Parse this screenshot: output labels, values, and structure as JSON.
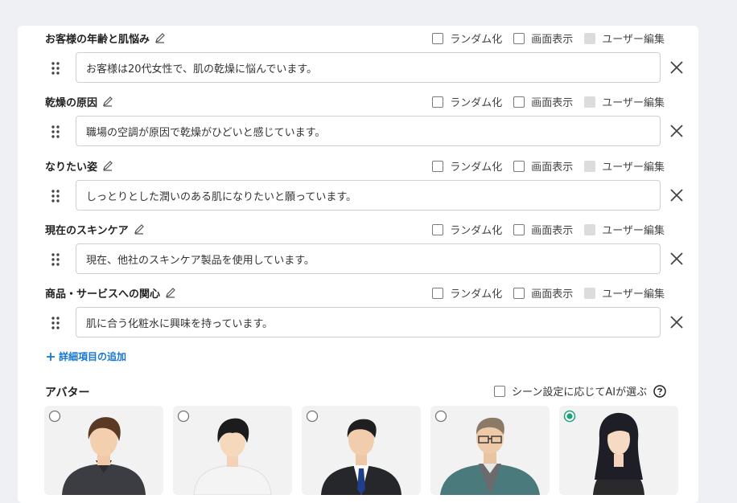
{
  "options": {
    "random": "ランダム化",
    "display": "画面表示",
    "user_edit": "ユーザー編集"
  },
  "fields": [
    {
      "label": "お客様の年齢と肌悩み",
      "value": "お客様は20代女性で、肌の乾燥に悩んでいます。"
    },
    {
      "label": "乾燥の原因",
      "value": "職場の空調が原因で乾燥がひどいと感じています。"
    },
    {
      "label": "なりたい姿",
      "value": "しっとりとした潤いのある肌になりたいと願っています。"
    },
    {
      "label": "現在のスキンケア",
      "value": "現在、他社のスキンケア製品を使用しています。"
    },
    {
      "label": "商品・サービスへの関心",
      "value": "肌に合う化粧水に興味を持っています。"
    }
  ],
  "add_detail": "詳細項目の追加",
  "avatar": {
    "title": "アバター",
    "ai_choice": "シーン設定に応じてAIが選ぶ",
    "selected_index": 4,
    "accent_color": "#1aa37a"
  },
  "colors": {
    "link": "#1677d2",
    "input_border": "#cfcfcf",
    "disabled_checkbox": "#dcdcdc"
  }
}
